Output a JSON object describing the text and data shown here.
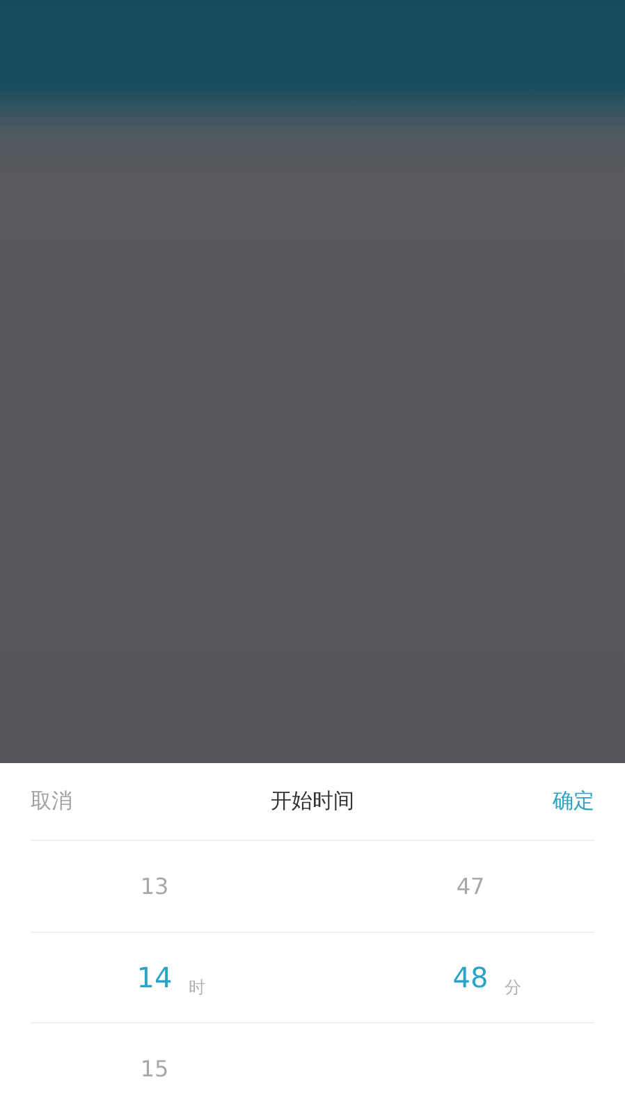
{
  "picker": {
    "cancel": "取消",
    "title": "开始时间",
    "confirm": "确定",
    "columns": [
      {
        "unit": "时",
        "items": [
          {
            "value": "13",
            "selected": false
          },
          {
            "value": "14",
            "selected": true
          },
          {
            "value": "15",
            "selected": false
          }
        ]
      },
      {
        "unit": "分",
        "items": [
          {
            "value": "47",
            "selected": false
          },
          {
            "value": "48",
            "selected": true
          }
        ]
      }
    ]
  }
}
